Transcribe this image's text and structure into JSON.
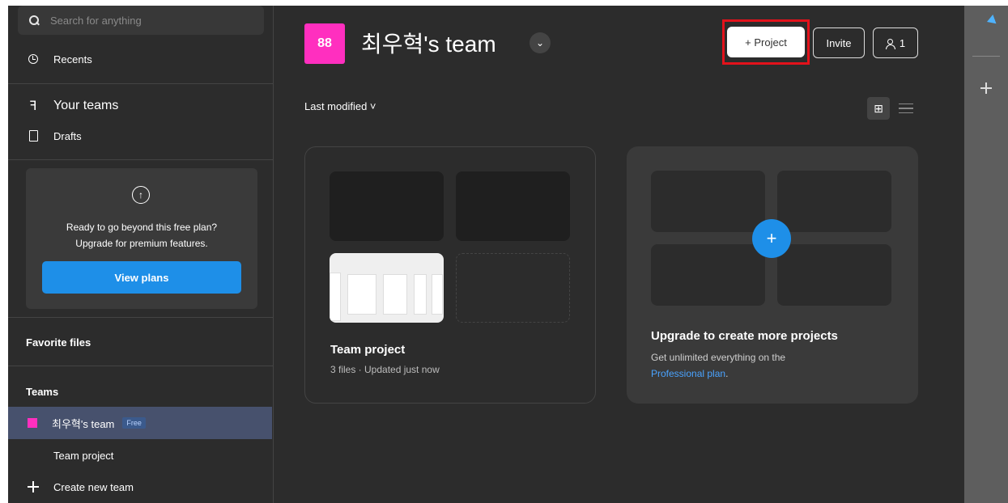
{
  "sidebar": {
    "search_placeholder": "Search for anything",
    "recents": "Recents",
    "your_teams": "Your teams",
    "drafts": "Drafts",
    "upgrade": {
      "line1": "Ready to go beyond this free plan?",
      "line2": "Upgrade for premium features.",
      "button": "View plans"
    },
    "favorite_files": "Favorite files",
    "teams_heading": "Teams",
    "team_name": "최우혁's team",
    "team_badge": "Free",
    "team_project": "Team project",
    "create_team": "Create new team"
  },
  "header": {
    "avatar_glyph": "88",
    "title": "최우혁's team",
    "project_button": "+ Project",
    "invite_button": "Invite",
    "members_count": "1"
  },
  "toolbar": {
    "sort_label": "Last modified ˅"
  },
  "cards": {
    "project": {
      "name": "Team project",
      "meta": "3 files · Updated just now"
    },
    "upgrade": {
      "title": "Upgrade to create more projects",
      "line1": "Get unlimited everything on the",
      "link": "Professional plan",
      "link_suffix": "."
    }
  },
  "colors": {
    "accent": "#1e8fe8",
    "team": "#ff2fbf",
    "highlight": "#e3121b"
  }
}
